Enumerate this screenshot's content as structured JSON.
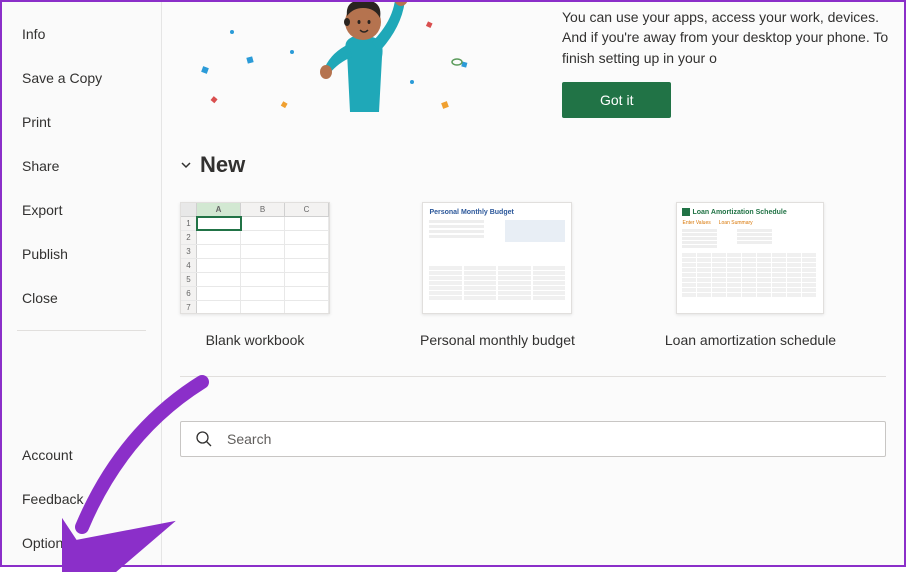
{
  "sidebar": {
    "items": [
      {
        "label": "Info"
      },
      {
        "label": "Save a Copy"
      },
      {
        "label": "Print"
      },
      {
        "label": "Share"
      },
      {
        "label": "Export"
      },
      {
        "label": "Publish"
      },
      {
        "label": "Close"
      }
    ],
    "bottom_items": [
      {
        "label": "Account"
      },
      {
        "label": "Feedback"
      },
      {
        "label": "Options"
      }
    ]
  },
  "banner": {
    "text": "You can use your apps, access your work, devices. And if you're away from your desktop your phone. To finish setting up in your o",
    "button": "Got it"
  },
  "new_section": {
    "title": "New",
    "templates": [
      {
        "label": "Blank workbook"
      },
      {
        "label": "Personal monthly budget"
      },
      {
        "label": "Loan amortization schedule"
      }
    ]
  },
  "blank_workbook": {
    "columns": [
      "A",
      "B",
      "C"
    ],
    "rows": [
      "1",
      "2",
      "3",
      "4",
      "5",
      "6",
      "7"
    ],
    "active_cell": "A1"
  },
  "budget_template": {
    "title": "Personal Monthly Budget"
  },
  "loan_template": {
    "title": "Loan Amortization Schedule",
    "sub1": "Enter Values",
    "sub2": "Loan Summary"
  },
  "search": {
    "placeholder": "Search"
  },
  "colors": {
    "accent": "#217346",
    "annotation": "#8b2fc9"
  }
}
